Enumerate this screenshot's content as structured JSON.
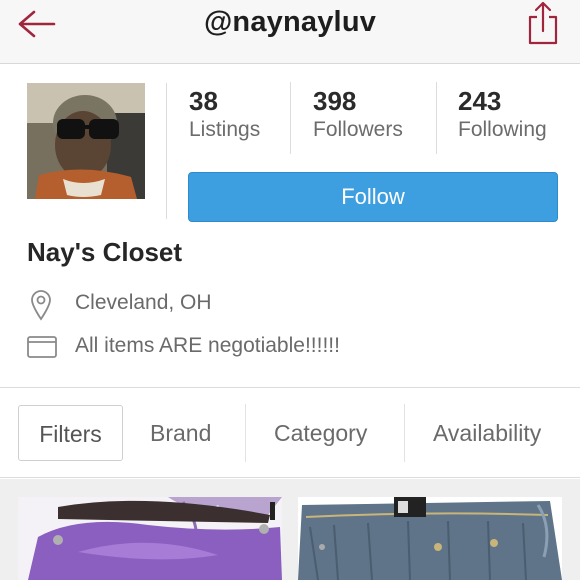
{
  "header": {
    "username": "@naynayluv",
    "back_icon": "back-arrow-icon",
    "share_icon": "share-icon",
    "accent": "#a0263d"
  },
  "profile": {
    "stats": [
      {
        "value": "38",
        "label": "Listings"
      },
      {
        "value": "398",
        "label": "Followers"
      },
      {
        "value": "243",
        "label": "Following"
      }
    ],
    "follow_label": "Follow",
    "follow_color": "#3d9ee0",
    "closet_name": "Nay's Closet",
    "location": "Cleveland, OH",
    "description": "All items ARE negotiable!!!!!!"
  },
  "filters": [
    "Filters",
    "Brand",
    "Category",
    "Availability"
  ],
  "listings": [
    {
      "item": "purple handbag"
    },
    {
      "item": "blue jeans"
    }
  ]
}
